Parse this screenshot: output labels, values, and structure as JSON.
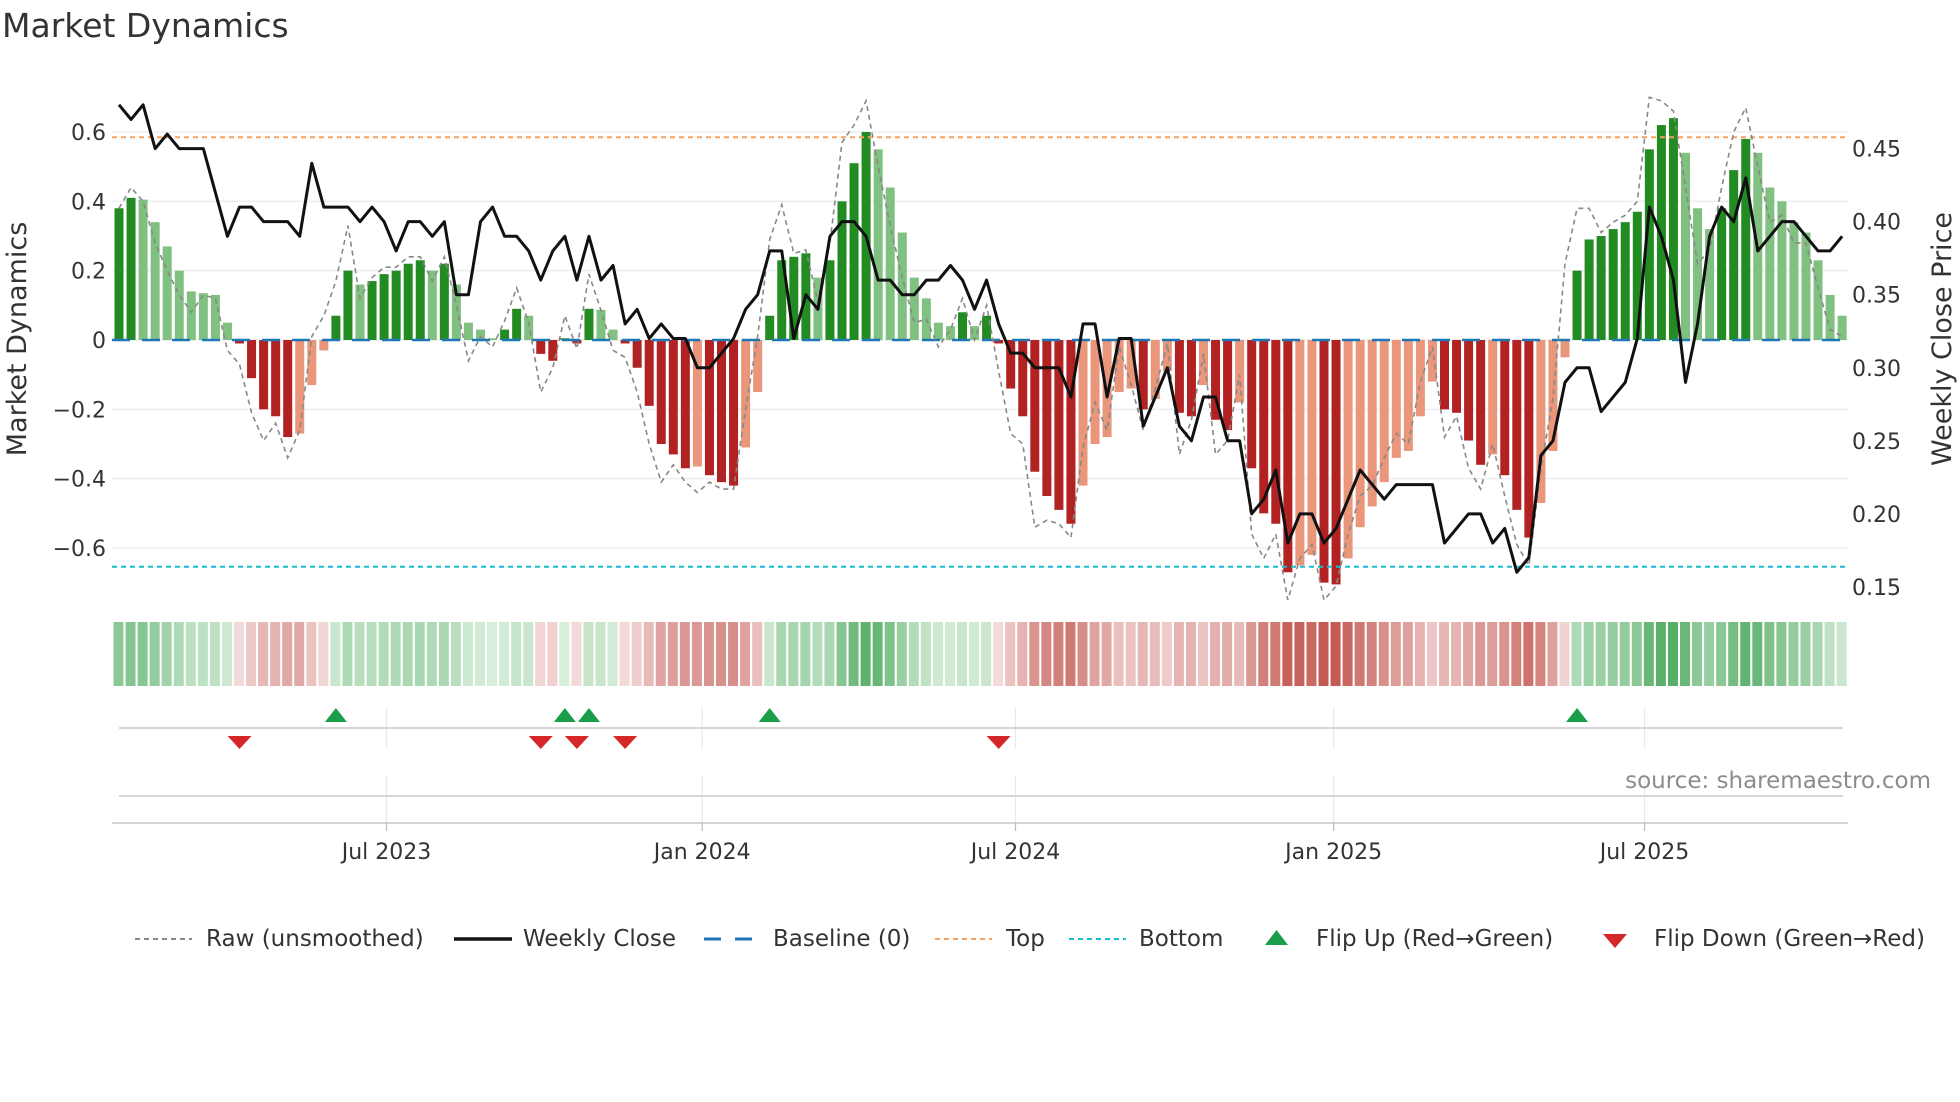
{
  "title": "Market Dynamics",
  "source": "source: sharemaestro.com",
  "legend": {
    "raw": "Raw (unsmoothed)",
    "close": "Weekly Close",
    "baseline": "Baseline (0)",
    "top": "Top",
    "bottom": "Bottom",
    "flip_up": "Flip Up (Red→Green)",
    "flip_down": "Flip Down (Green→Red)"
  },
  "colors": {
    "pos_strong": "#228b22",
    "pos_fading": "#80c080",
    "neg_strong": "#b22222",
    "neg_fading": "#e9967a",
    "raw": "#888888",
    "close": "#111111",
    "baseline": "#1f77b4",
    "top": "#f4a460",
    "bottom": "#17becf",
    "flip_up": "#1a9e4a",
    "flip_down": "#d62728",
    "grid": "#eceef3"
  },
  "chart_data": {
    "type": "bar",
    "title": "Market Dynamics",
    "xlabel": "",
    "ylabel": "Market Dynamics",
    "ylabel_right": "Weekly Close Price",
    "frequency": "weekly",
    "ylim": [
      -0.75,
      0.75
    ],
    "ylim_right": [
      0.141,
      0.497
    ],
    "yticks": [
      {
        "value": -0.6,
        "label": "−0.6"
      },
      {
        "value": -0.4,
        "label": "−0.4"
      },
      {
        "value": -0.2,
        "label": "−0.2"
      },
      {
        "value": 0,
        "label": "0"
      },
      {
        "value": 0.2,
        "label": "0.2"
      },
      {
        "value": 0.4,
        "label": "0.4"
      },
      {
        "value": 0.6,
        "label": "0.6"
      }
    ],
    "yticks_right": [
      {
        "value": 0.15,
        "label": "0.15"
      },
      {
        "value": 0.2,
        "label": "0.20"
      },
      {
        "value": 0.25,
        "label": "0.25"
      },
      {
        "value": 0.3,
        "label": "0.30"
      },
      {
        "value": 0.35,
        "label": "0.35"
      },
      {
        "value": 0.4,
        "label": "0.40"
      },
      {
        "value": 0.45,
        "label": "0.45"
      }
    ],
    "xticks": [
      {
        "index": 22.2,
        "label": "Jul 2023"
      },
      {
        "index": 48.4,
        "label": "Jan 2024"
      },
      {
        "index": 74.4,
        "label": "Jul 2024"
      },
      {
        "index": 100.8,
        "label": "Jan 2025"
      },
      {
        "index": 126.6,
        "label": "Jul 2025"
      }
    ],
    "top_level": 0.585,
    "bottom_level": -0.654,
    "baseline": 0,
    "dynamics": [
      0.38,
      0.41,
      0.405,
      0.34,
      0.27,
      0.2,
      0.14,
      0.135,
      0.13,
      0.05,
      -0.01,
      -0.11,
      -0.2,
      -0.22,
      -0.28,
      -0.27,
      -0.13,
      -0.03,
      0.07,
      0.2,
      0.16,
      0.17,
      0.19,
      0.2,
      0.22,
      0.23,
      0.2,
      0.22,
      0.16,
      0.05,
      0.03,
      0.005,
      0.03,
      0.09,
      0.07,
      -0.04,
      -0.06,
      0.005,
      -0.01,
      0.09,
      0.087,
      0.03,
      -0.01,
      -0.08,
      -0.19,
      -0.3,
      -0.33,
      -0.37,
      -0.365,
      -0.39,
      -0.41,
      -0.42,
      -0.31,
      -0.15,
      0.07,
      0.23,
      0.24,
      0.25,
      0.18,
      0.23,
      0.4,
      0.51,
      0.6,
      0.55,
      0.44,
      0.31,
      0.18,
      0.12,
      0.05,
      0.04,
      0.08,
      0.04,
      0.07,
      -0.01,
      -0.14,
      -0.22,
      -0.38,
      -0.45,
      -0.49,
      -0.53,
      -0.42,
      -0.3,
      -0.28,
      -0.15,
      -0.14,
      -0.2,
      -0.17,
      -0.09,
      -0.21,
      -0.22,
      -0.13,
      -0.23,
      -0.26,
      -0.18,
      -0.37,
      -0.5,
      -0.53,
      -0.67,
      -0.65,
      -0.62,
      -0.7,
      -0.705,
      -0.63,
      -0.54,
      -0.48,
      -0.41,
      -0.34,
      -0.32,
      -0.22,
      -0.12,
      -0.2,
      -0.21,
      -0.29,
      -0.36,
      -0.33,
      -0.39,
      -0.49,
      -0.57,
      -0.47,
      -0.32,
      -0.05,
      0.2,
      0.29,
      0.3,
      0.32,
      0.34,
      0.37,
      0.55,
      0.62,
      0.64,
      0.54,
      0.38,
      0.32,
      0.38,
      0.49,
      0.58,
      0.54,
      0.44,
      0.4,
      0.34,
      0.31,
      0.23,
      0.13,
      0.07
    ],
    "raw": [
      0.38,
      0.44,
      0.4,
      0.28,
      0.2,
      0.13,
      0.08,
      0.13,
      0.12,
      -0.03,
      -0.07,
      -0.21,
      -0.29,
      -0.24,
      -0.34,
      -0.26,
      0.01,
      0.07,
      0.17,
      0.33,
      0.12,
      0.18,
      0.21,
      0.21,
      0.24,
      0.24,
      0.17,
      0.24,
      0.1,
      -0.06,
      0.01,
      -0.02,
      0.055,
      0.15,
      0.05,
      -0.15,
      -0.08,
      0.07,
      -0.025,
      0.19,
      0.085,
      -0.03,
      -0.05,
      -0.15,
      -0.3,
      -0.41,
      -0.36,
      -0.41,
      -0.44,
      -0.41,
      -0.43,
      -0.43,
      -0.2,
      0.01,
      0.29,
      0.39,
      0.25,
      0.26,
      0.11,
      0.28,
      0.57,
      0.62,
      0.69,
      0.5,
      0.33,
      0.18,
      0.05,
      0.06,
      -0.02,
      0.03,
      0.12,
      0.0,
      0.1,
      -0.09,
      -0.27,
      -0.3,
      -0.54,
      -0.52,
      -0.53,
      -0.57,
      -0.31,
      -0.18,
      -0.26,
      -0.02,
      -0.13,
      -0.26,
      -0.14,
      -0.01,
      -0.33,
      -0.23,
      -0.04,
      -0.33,
      -0.29,
      -0.1,
      -0.56,
      -0.63,
      -0.56,
      -0.75,
      -0.63,
      -0.59,
      -0.75,
      -0.71,
      -0.56,
      -0.45,
      -0.42,
      -0.34,
      -0.27,
      -0.3,
      -0.12,
      -0.02,
      -0.28,
      -0.22,
      -0.37,
      -0.43,
      -0.3,
      -0.45,
      -0.59,
      -0.65,
      -0.37,
      -0.17,
      0.22,
      0.38,
      0.38,
      0.31,
      0.34,
      0.36,
      0.4,
      0.7,
      0.69,
      0.66,
      0.44,
      0.22,
      0.26,
      0.44,
      0.6,
      0.67,
      0.5,
      0.34,
      0.36,
      0.28,
      0.28,
      0.15,
      0.03,
      0.01
    ],
    "weekly_close": [
      0.48,
      0.47,
      0.48,
      0.45,
      0.46,
      0.45,
      0.45,
      0.45,
      0.42,
      0.39,
      0.41,
      0.41,
      0.4,
      0.4,
      0.4,
      0.39,
      0.44,
      0.41,
      0.41,
      0.41,
      0.4,
      0.41,
      0.4,
      0.38,
      0.4,
      0.4,
      0.39,
      0.4,
      0.35,
      0.35,
      0.4,
      0.41,
      0.39,
      0.39,
      0.38,
      0.36,
      0.38,
      0.39,
      0.36,
      0.39,
      0.36,
      0.37,
      0.33,
      0.34,
      0.32,
      0.33,
      0.32,
      0.32,
      0.3,
      0.3,
      0.31,
      0.32,
      0.34,
      0.35,
      0.38,
      0.38,
      0.32,
      0.35,
      0.34,
      0.39,
      0.4,
      0.4,
      0.39,
      0.36,
      0.36,
      0.35,
      0.35,
      0.36,
      0.36,
      0.37,
      0.36,
      0.34,
      0.36,
      0.33,
      0.31,
      0.31,
      0.3,
      0.3,
      0.3,
      0.28,
      0.33,
      0.33,
      0.28,
      0.32,
      0.32,
      0.26,
      0.28,
      0.3,
      0.26,
      0.25,
      0.28,
      0.28,
      0.25,
      0.25,
      0.2,
      0.21,
      0.23,
      0.18,
      0.2,
      0.2,
      0.18,
      0.19,
      0.21,
      0.23,
      0.22,
      0.21,
      0.22,
      0.22,
      0.22,
      0.22,
      0.18,
      0.19,
      0.2,
      0.2,
      0.18,
      0.19,
      0.16,
      0.17,
      0.24,
      0.25,
      0.29,
      0.3,
      0.3,
      0.27,
      0.28,
      0.29,
      0.32,
      0.41,
      0.39,
      0.36,
      0.29,
      0.33,
      0.39,
      0.41,
      0.4,
      0.43,
      0.38,
      0.39,
      0.4,
      0.4,
      0.39,
      0.38,
      0.38,
      0.39
    ],
    "flip_up_indices": [
      18,
      37,
      39,
      54,
      121
    ],
    "flip_down_indices": [
      10,
      35,
      38,
      42,
      73
    ],
    "grid": true,
    "legend_position": "bottom"
  }
}
